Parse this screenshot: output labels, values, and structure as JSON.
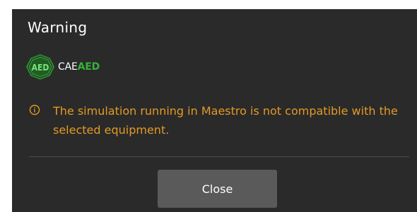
{
  "dialog": {
    "title": "Warning",
    "device": {
      "logo_text": "AED",
      "vendor": "CAE",
      "model": "AED"
    },
    "message": "The simulation running in Maestro is not compatible with the selected equipment.",
    "close_label": "Close"
  },
  "icons": {
    "logo": "aed-logo-icon",
    "info": "info-circle-icon"
  },
  "colors": {
    "dialog_background": "#2a2a2a",
    "warning_text": "#e39a24",
    "brand_green": "#35b23a",
    "button_background": "#5a5a5a"
  }
}
